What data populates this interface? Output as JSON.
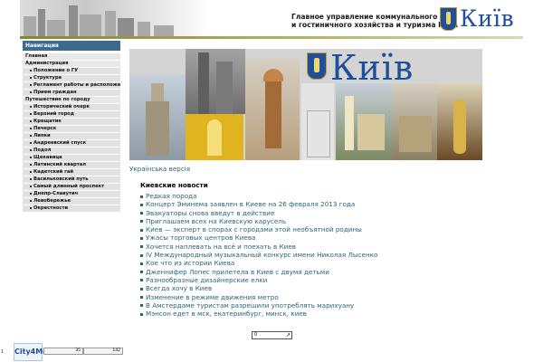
{
  "header": {
    "org_line1": "Главное управление коммунального",
    "org_line2": "и гостиничного хозяйства и туризма КГГА",
    "city_logo": "Київ"
  },
  "colors": {
    "nav_header": "#3d6b8f",
    "link": "#2a6478",
    "logo_blue": "#1f4f99",
    "rule_olive": "#7f8a2e"
  },
  "sidebar": {
    "title": "Навигация",
    "items": [
      {
        "label": "Главная",
        "sub": false
      },
      {
        "label": "Администрация",
        "sub": false
      },
      {
        "label": "Положение о ГУ",
        "sub": true
      },
      {
        "label": "Структура",
        "sub": true
      },
      {
        "label": "Регламент работы и расположение",
        "sub": true
      },
      {
        "label": "Прием граждан",
        "sub": true
      },
      {
        "label": "Путешествие по городу",
        "sub": false
      },
      {
        "label": "Исторический очерк",
        "sub": true
      },
      {
        "label": "Верхний город",
        "sub": true
      },
      {
        "label": "Крещатик",
        "sub": true
      },
      {
        "label": "Печерск",
        "sub": true
      },
      {
        "label": "Липки",
        "sub": true
      },
      {
        "label": "Андреевский спуск",
        "sub": true
      },
      {
        "label": "Подол",
        "sub": true
      },
      {
        "label": "Щекавица",
        "sub": true
      },
      {
        "label": "Латинский квартал",
        "sub": true
      },
      {
        "label": "Кадетский гай",
        "sub": true
      },
      {
        "label": "Васильковский путь",
        "sub": true
      },
      {
        "label": "Самый длинный проспект",
        "sub": true
      },
      {
        "label": "Днепр-Славутич",
        "sub": true
      },
      {
        "label": "Левобережье",
        "sub": true
      },
      {
        "label": "Окрестности",
        "sub": true
      }
    ]
  },
  "hero": {
    "logo": "Київ"
  },
  "content": {
    "ukrainian_link": "Українська версія",
    "news_heading": "Киевские новости",
    "news": [
      "Редкая порода",
      "Концерт Эминема заявлен в Киеве на 26 февраля 2013 года",
      "Эвакуаторы снова введут в действие",
      "Приглашаем всех на Киевскую карусель",
      "Киев — эксперт в спорах с городами этой необъятной родины",
      "Ужасы торговых центров Киева",
      "Хочется наплевать на всё и поехать в Киев",
      "IV Международный музыкальный конкурс имени Николая Лысенко",
      "Кое что из истории Киева",
      "Дженнифер Лопес прилетела в Киев с двумя детьми",
      "Разнообразные дизайнерские елки",
      "Всегда хочу в Киев",
      "Изменение в режиме движения метро",
      "В Амстердаме туристам разрешили употреблять марихуану",
      "Мэнсон едет в мск, екатеринбург, минск, киев"
    ]
  },
  "counter": {
    "value": "0",
    "arrow": "↗"
  },
  "footer": {
    "left_number": "1",
    "city4me_label": "City4Me",
    "bar_a_value": "35",
    "bar_b_value": "142"
  }
}
